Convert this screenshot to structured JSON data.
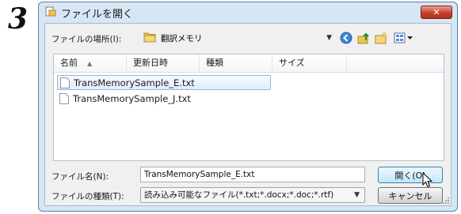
{
  "step_number": "3",
  "dialog": {
    "title": "ファイルを開く",
    "close_label": "✕"
  },
  "location": {
    "label": "ファイルの場所(I):",
    "value": "翻訳メモリ"
  },
  "toolbar": {
    "icons": [
      "back-icon",
      "up-folder-icon",
      "new-folder-icon",
      "view-menu-icon"
    ]
  },
  "columns": [
    "名前",
    "更新日時",
    "種類",
    "サイズ"
  ],
  "files": [
    {
      "name": "TransMemorySample_E.txt",
      "selected": true
    },
    {
      "name": "TransMemorySample_J.txt",
      "selected": false
    }
  ],
  "filename": {
    "label": "ファイル名(N):",
    "value": "TransMemorySample_E.txt"
  },
  "filetype": {
    "label": "ファイルの種類(T):",
    "value": "読み込み可能なファイル(*.txt;*.docx;*.doc;*.rtf)"
  },
  "buttons": {
    "open": "開く(O)",
    "cancel": "キャンセル"
  }
}
